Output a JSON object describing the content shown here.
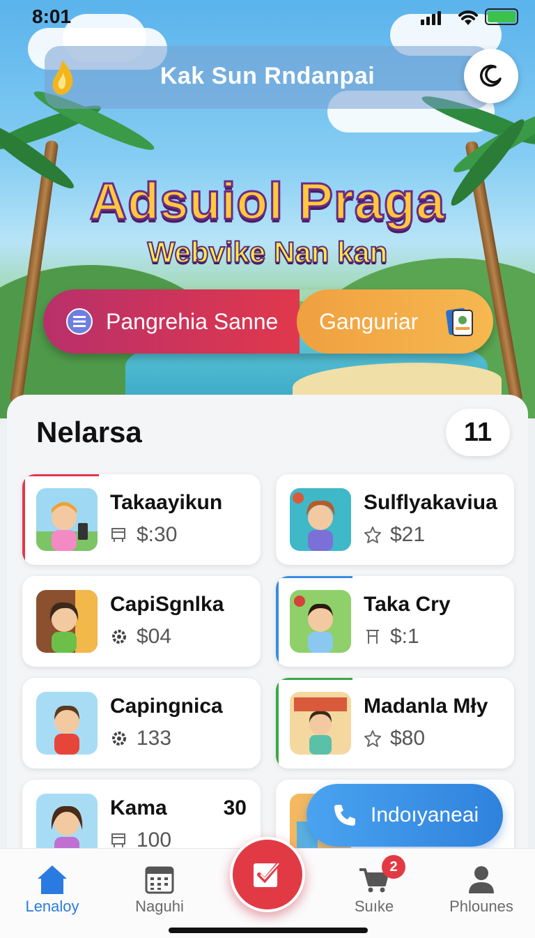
{
  "status_bar": {
    "time": "8:01"
  },
  "header": {
    "title": "Kak Sun Rndanpai",
    "theme_icon": "moon-icon"
  },
  "hero": {
    "headline": "Adsuiol Praga",
    "subline": "Webvike Nan kan"
  },
  "segments": {
    "left_label": "Pangrehia Sanne",
    "left_icon": "list-icon",
    "right_label": "Ganguriar",
    "right_icon": "card-icon"
  },
  "section": {
    "title": "Nelarsa",
    "count": "11"
  },
  "cards": [
    {
      "name": "Takaayikun",
      "meta": "$:30",
      "meta_icon": "cart-icon",
      "accent": "#e0384c"
    },
    {
      "name": "Sulflyakaviua",
      "meta": "$21",
      "meta_icon": "star-icon",
      "accent": ""
    },
    {
      "name": "CapiSgnlka",
      "meta": "$04",
      "meta_icon": "gear-icon",
      "accent": ""
    },
    {
      "name": "Taka Cry",
      "meta": "$:1",
      "meta_icon": "cart-icon",
      "accent": "#3a8be0"
    },
    {
      "name": "Capingnica",
      "meta": "133",
      "meta_icon": "gear-icon",
      "accent": ""
    },
    {
      "name": "Madanla Mły",
      "meta": "$80",
      "meta_icon": "star-icon",
      "accent": "#3aa84a"
    },
    {
      "name": "Kama",
      "meta": "100",
      "meta_icon": "cart-icon",
      "extra": "30",
      "accent": ""
    }
  ],
  "call_button": {
    "label": "Indoıyaneai",
    "icon": "phone-icon"
  },
  "tabs": [
    {
      "label": "Lenaloy",
      "icon": "home-icon",
      "active": true
    },
    {
      "label": "Naguhi",
      "icon": "calendar-icon",
      "active": false
    },
    {
      "label": "Suıke",
      "icon": "cart-icon",
      "badge": "2",
      "active": false
    },
    {
      "label": "Phlounes",
      "icon": "profile-icon",
      "active": false
    }
  ],
  "colors": {
    "primary": "#2a7be0",
    "accent_red": "#e23a44",
    "segment_orange": "#f0a040"
  }
}
